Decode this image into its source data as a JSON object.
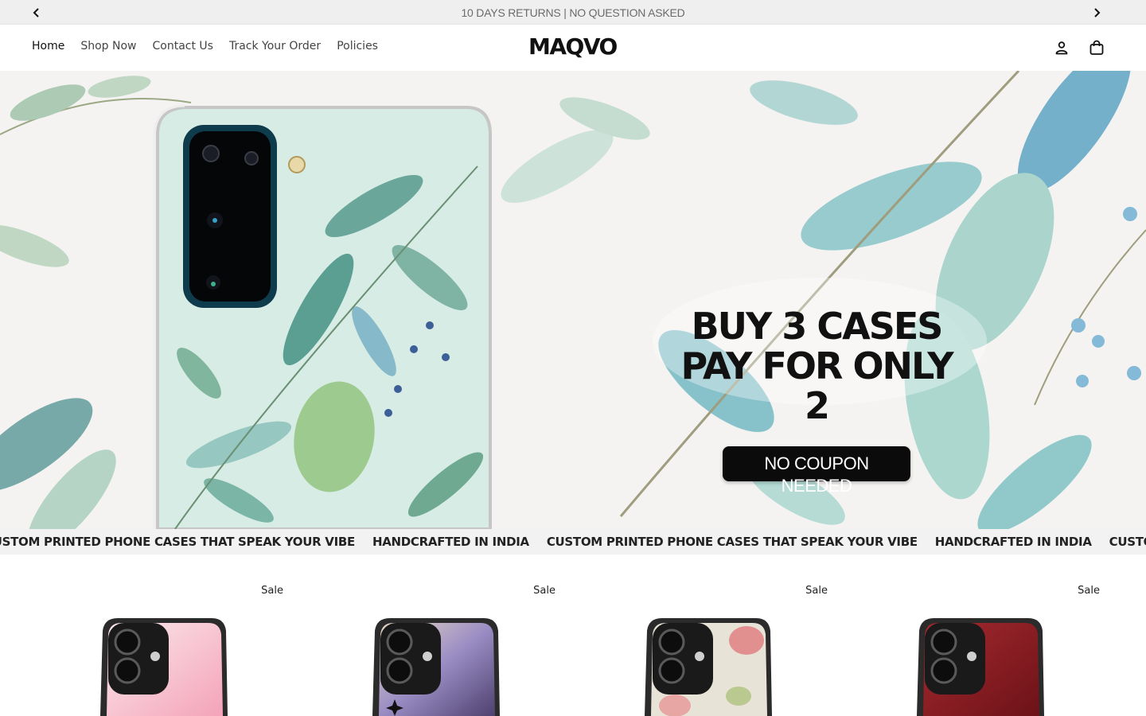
{
  "announcement": {
    "text": "10 DAYS RETURNS | NO QUESTION ASKED",
    "prev_icon": "chevron-left-icon",
    "next_icon": "chevron-right-icon"
  },
  "header": {
    "nav": [
      {
        "label": "Home"
      },
      {
        "label": "Shop Now"
      },
      {
        "label": "Contact Us"
      },
      {
        "label": "Track Your Order"
      },
      {
        "label": "Policies"
      }
    ],
    "logo_text": "MAQVO",
    "account_icon": "user-icon",
    "cart_icon": "shopping-bag-icon"
  },
  "hero": {
    "line1": "BUY 3 CASES",
    "line2": "PAY FOR ONLY 2",
    "badge": "NO COUPON NEEDED"
  },
  "ticker": {
    "items": [
      "CUSTOM PRINTED PHONE CASES THAT SPEAK YOUR VIBE",
      "HANDCRAFTED IN INDIA",
      "CUSTOM PRINTED PHONE CASES THAT SPEAK YOUR VIBE",
      "HANDCRAFTED IN INDIA",
      "CUSTOM PRINTED PHONE CASES THAT SPEAK YOUR VIBE"
    ]
  },
  "products": [
    {
      "badge": "Sale",
      "color_a": "#fbe9ec",
      "color_b": "#f4a3b9"
    },
    {
      "badge": "Sale",
      "color_a": "#c9c5dc",
      "color_b": "#6d5f9a"
    },
    {
      "badge": "Sale",
      "color_a": "#ebe6dc",
      "color_b": "#e5a7a4"
    },
    {
      "badge": "Sale",
      "color_a": "#a52a2f",
      "color_b": "#6c1218"
    }
  ],
  "colors": {
    "accent": "#111111",
    "announce_bg": "#efefef",
    "leaf_teal": "#6fb4bd",
    "leaf_green": "#8dbf9d"
  }
}
